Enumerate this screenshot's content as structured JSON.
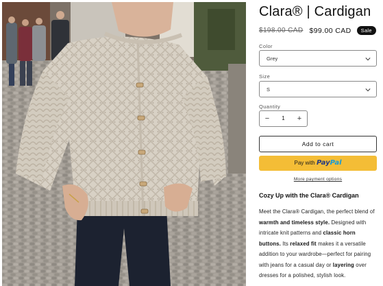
{
  "product": {
    "name": "Clara® | Cardigan",
    "price_original": "$198.00 CAD",
    "price_sale": "$99.00 CAD",
    "sale_badge": "Sale"
  },
  "options": {
    "color": {
      "label": "Color",
      "value": "Grey"
    },
    "size": {
      "label": "Size",
      "value": "S"
    },
    "quantity": {
      "label": "Quantity",
      "value": "1",
      "decrease": "−",
      "increase": "+"
    }
  },
  "actions": {
    "add_to_cart": "Add to cart",
    "paypal_prefix": "Pay with",
    "paypal_logo_a": "Pay",
    "paypal_logo_b": "Pal",
    "more_payment": "More payment options"
  },
  "description": {
    "title": "Cozy Up with the Clara® Cardigan",
    "p1": "Meet the Clara® Cardigan, the perfect blend of ",
    "b1": "warmth and timeless style.",
    "p2": " Designed with intricate knit patterns and ",
    "b2": "classic horn buttons.",
    "p3": " Its ",
    "b3": "relaxed fit",
    "p4": " makes it a versatile addition to your wardrobe—perfect for pairing with jeans for a casual day or ",
    "b4": "layering",
    "p5": " over dresses for a polished, stylish look."
  },
  "icons": {
    "chevron": "chevron-down-icon",
    "paypal": "paypal-logo"
  },
  "colors": {
    "sale_badge": "#121212",
    "paypal_button": "#f4bd36",
    "paypal_dark": "#253b80",
    "paypal_light": "#179bd7"
  }
}
